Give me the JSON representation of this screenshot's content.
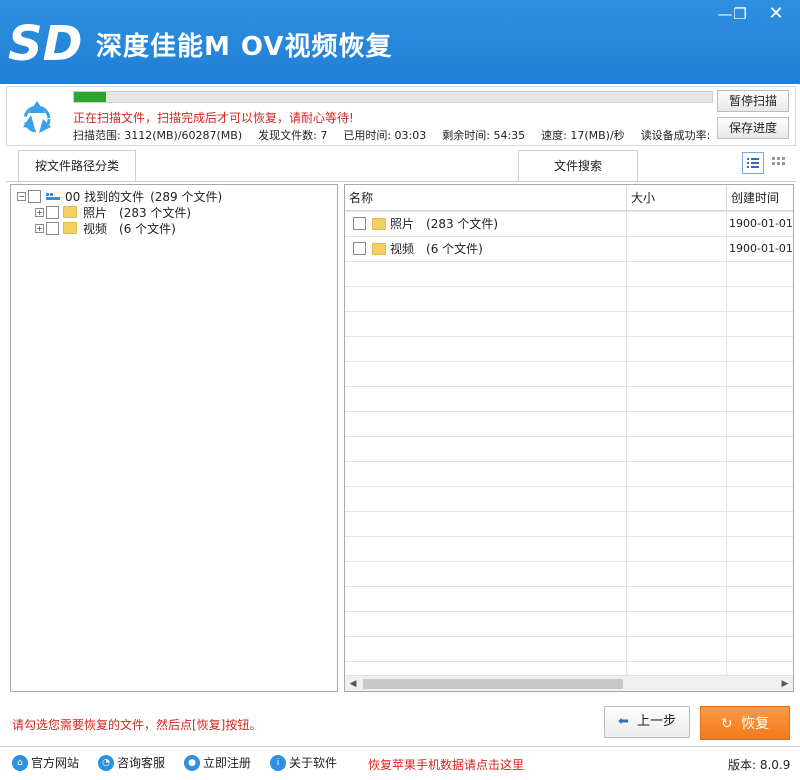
{
  "window": {
    "title": "深度佳能M OV视频恢复",
    "min_icon": "minimize-icon",
    "max_icon": "maximize-icon",
    "close_icon": "close-icon"
  },
  "status": {
    "progress_percent": 5,
    "message": "正在扫描文件，扫描完成后才可以恢复，请耐心等待!",
    "scan_range": "扫描范围: 3112(MB)/60287(MB)",
    "found": "发现文件数: 7",
    "elapsed": "已用时间: 03:03",
    "remaining": "剩余时间: 54:35",
    "speed": "速度: 17(MB)/秒",
    "read_rate": "读设备成功率:",
    "pause_label": "暂停扫描",
    "save_label": "保存进度"
  },
  "tabs": {
    "path_label": "按文件路径分类",
    "search_label": "文件搜索"
  },
  "tree": {
    "root": {
      "label": "00 找到的文件",
      "count": "(289 个文件)"
    },
    "children": [
      {
        "label": "照片",
        "count": "(283 个文件)"
      },
      {
        "label": "视频",
        "count": "(6 个文件)"
      }
    ]
  },
  "filelist": {
    "columns": {
      "name": "名称",
      "size": "大小",
      "date": "创建时间"
    },
    "rows": [
      {
        "name": "照片",
        "count": "(283 个文件)",
        "date": "1900-01-01"
      },
      {
        "name": "视频",
        "count": "(6 个文件)",
        "date": "1900-01-01"
      }
    ]
  },
  "bottom": {
    "hint": "请勾选您需要恢复的文件，然后点[恢复]按钮。",
    "prev_label": "上一步",
    "restore_label": "恢复"
  },
  "footer": {
    "website": "官方网站",
    "support": "咨询客服",
    "register": "立即注册",
    "about": "关于软件",
    "apple_link": "恢复苹果手机数据请点击这里",
    "version": "版本: 8.0.9"
  },
  "colors": {
    "title_bg": "#1f7fd6",
    "progress": "#2da42d",
    "alert_text": "#d4261f",
    "restore_button": "#f27a1a"
  }
}
